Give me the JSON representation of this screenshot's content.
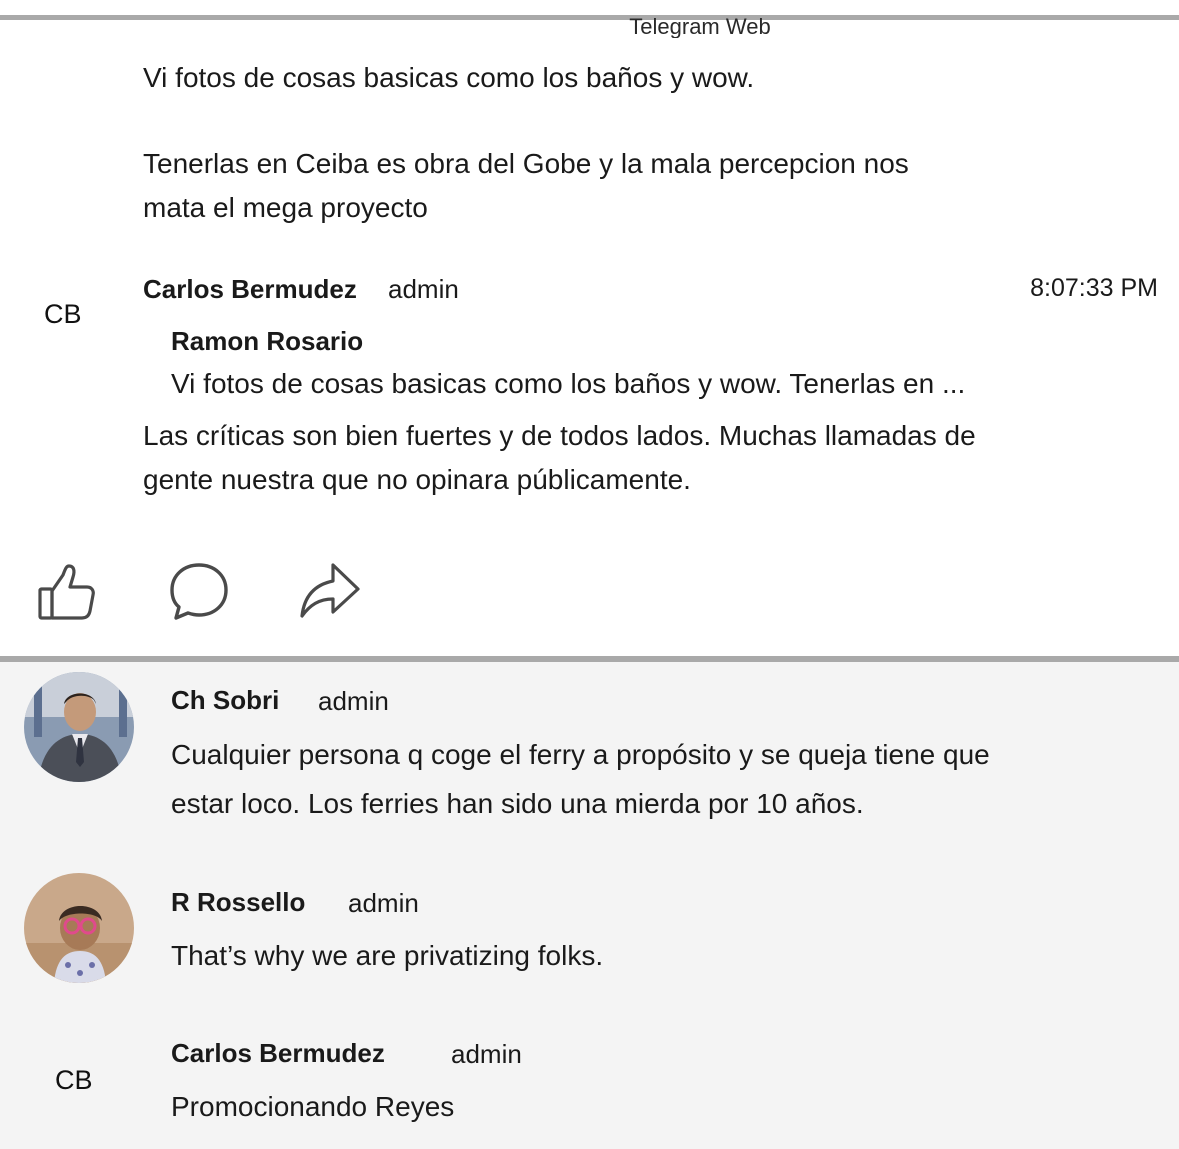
{
  "app": {
    "title": "Telegram Web"
  },
  "prev_message": {
    "para1": "Vi fotos de cosas basicas como los baños y wow.",
    "para2_line1": "Tenerlas en Ceiba es obra del Gobe y la mala percepcion nos",
    "para2_line2": "mata el mega proyecto"
  },
  "message1": {
    "initials": "CB",
    "sender": "Carlos Bermudez",
    "role": "admin",
    "time": "8:07:33 PM",
    "reply": {
      "author": "Ramon Rosario",
      "preview": "Vi fotos de cosas basicas como los baños y wow. Tenerlas en ..."
    },
    "line1": "Las críticas son bien fuertes y de todos lados. Muchas llamadas de",
    "line2": "gente nuestra que no opinara públicamente."
  },
  "actions": {
    "icons": [
      "thumbs-up-icon",
      "comment-icon",
      "forward-icon"
    ]
  },
  "message2": {
    "sender": "Ch Sobri",
    "role": "admin",
    "line1": "Cualquier persona q coge el ferry a propósito y se queja tiene que",
    "line2": "estar loco. Los ferries han sido una mierda por 10 años."
  },
  "message3": {
    "sender": "R Rossello",
    "role": "admin",
    "line1": "That’s why we are privatizing folks."
  },
  "message4": {
    "initials": "CB",
    "sender": "Carlos Bermudez",
    "role": "admin",
    "line1": "Promocionando Reyes"
  },
  "colors": {
    "divider": "#a9a9a9",
    "lower_background": "#f4f4f4",
    "text": "#1a1a1a"
  }
}
